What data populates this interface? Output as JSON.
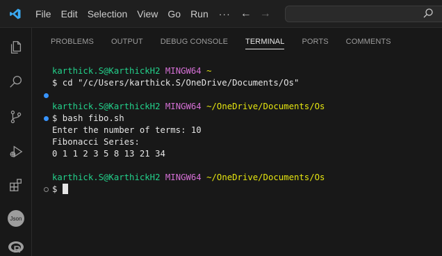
{
  "menu": {
    "items": [
      "File",
      "Edit",
      "Selection",
      "View",
      "Go",
      "Run"
    ],
    "more": "···"
  },
  "panel": {
    "tabs": [
      {
        "label": "PROBLEMS",
        "active": false
      },
      {
        "label": "OUTPUT",
        "active": false
      },
      {
        "label": "DEBUG CONSOLE",
        "active": false
      },
      {
        "label": "TERMINAL",
        "active": true
      },
      {
        "label": "PORTS",
        "active": false
      },
      {
        "label": "COMMENTS",
        "active": false
      }
    ]
  },
  "activity_icons": [
    "explorer-icon",
    "search-icon",
    "source-control-icon",
    "run-debug-icon",
    "extensions-icon",
    "json-icon",
    "r-icon"
  ],
  "terminal": {
    "user_host": "karthick.S@KarthickH2",
    "shell": "MINGW64",
    "prompt1": {
      "path": "~",
      "command": "$ cd \"/c/Users/karthick.S/OneDrive/Documents/Os\""
    },
    "prompt2": {
      "path": "~/OneDrive/Documents/Os",
      "command": "$ bash fibo.sh"
    },
    "output": [
      "Enter the number of terms: 10",
      "Fibonacci Series:",
      "0 1 1 2 3 5 8 13 21 34"
    ],
    "prompt3": {
      "path": "~/OneDrive/Documents/Os",
      "command": "$ "
    }
  },
  "colors": {
    "user": "#23d18b",
    "shell": "#d670d6",
    "path": "#e5e510",
    "accent": "#3794ff",
    "vscode_logo": "#3aa8f0"
  }
}
